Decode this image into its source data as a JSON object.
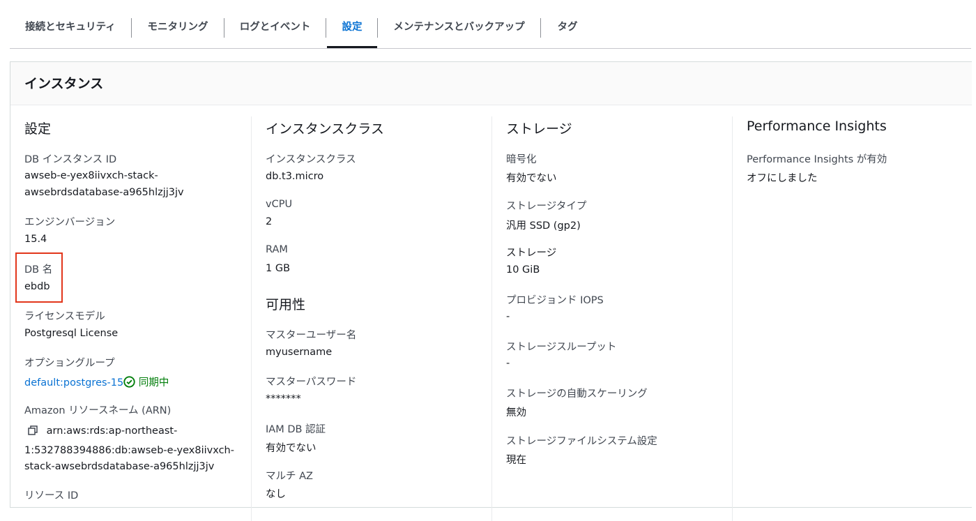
{
  "tabs": [
    {
      "label": "接続とセキュリティ"
    },
    {
      "label": "モニタリング"
    },
    {
      "label": "ログとイベント"
    },
    {
      "label": "設定"
    },
    {
      "label": "メンテナンスとバックアップ"
    },
    {
      "label": "タグ"
    }
  ],
  "active_tab": "設定",
  "panel": {
    "title": "インスタンス"
  },
  "settings": {
    "title": "設定",
    "db_instance_id_label": "DB インスタンス ID",
    "db_instance_id_line1": "awseb-e-yex8iivxch-stack-",
    "db_instance_id_line2": "awsebrdsdatabase-a965hlzjj3jv",
    "engine_version_label": "エンジンバージョン",
    "engine_version": "15.4",
    "db_name_label": "DB 名",
    "db_name": "ebdb",
    "license_label": "ライセンスモデル",
    "license": "Postgresql License",
    "option_group_label": "オプショングループ",
    "option_group": "default:postgres-15",
    "option_group_status": "同期中",
    "arn_label": "Amazon リソースネーム (ARN)",
    "arn_line1": "arn:aws:rds:ap-northeast-",
    "arn_line2": "1:532788394886:db:awseb-e-yex8iivxch-",
    "arn_line3": "stack-awsebrdsdatabase-a965hlzjj3jv",
    "resource_id_label": "リソース ID"
  },
  "instance_class": {
    "title": "インスタンスクラス",
    "class_label": "インスタンスクラス",
    "class": "db.t3.micro",
    "vcpu_label": "vCPU",
    "vcpu": "2",
    "ram_label": "RAM",
    "ram": "1 GB"
  },
  "availability": {
    "title": "可用性",
    "master_user_label": "マスターユーザー名",
    "master_user": "myusername",
    "master_password_label": "マスターパスワード",
    "master_password": "*******",
    "iam_auth_label": "IAM DB 認証",
    "iam_auth": "有効でない",
    "multi_az_label": "マルチ AZ",
    "multi_az": "なし"
  },
  "storage": {
    "title": "ストレージ",
    "encryption_label": "暗号化",
    "encryption": "有効でない",
    "type_label": "ストレージタイプ",
    "type": "汎用 SSD (gp2)",
    "storage_label": "ストレージ",
    "storage": "10 GiB",
    "iops_label": "プロビジョンド IOPS",
    "iops": "-",
    "throughput_label": "ストレージスループット",
    "throughput": "-",
    "autoscaling_label": "ストレージの自動スケーリング",
    "autoscaling": "無効",
    "fs_config_label": "ストレージファイルシステム設定",
    "fs_config": "現在"
  },
  "performance_insights": {
    "title": "Performance Insights",
    "enabled_label": "Performance Insights が有効",
    "enabled": "オフにしました"
  },
  "icons": {
    "copy": "copy-icon",
    "status": "check-circle-icon"
  },
  "colors": {
    "link": "#0972d3",
    "success": "#037f0c",
    "highlight": "#e2361b"
  }
}
